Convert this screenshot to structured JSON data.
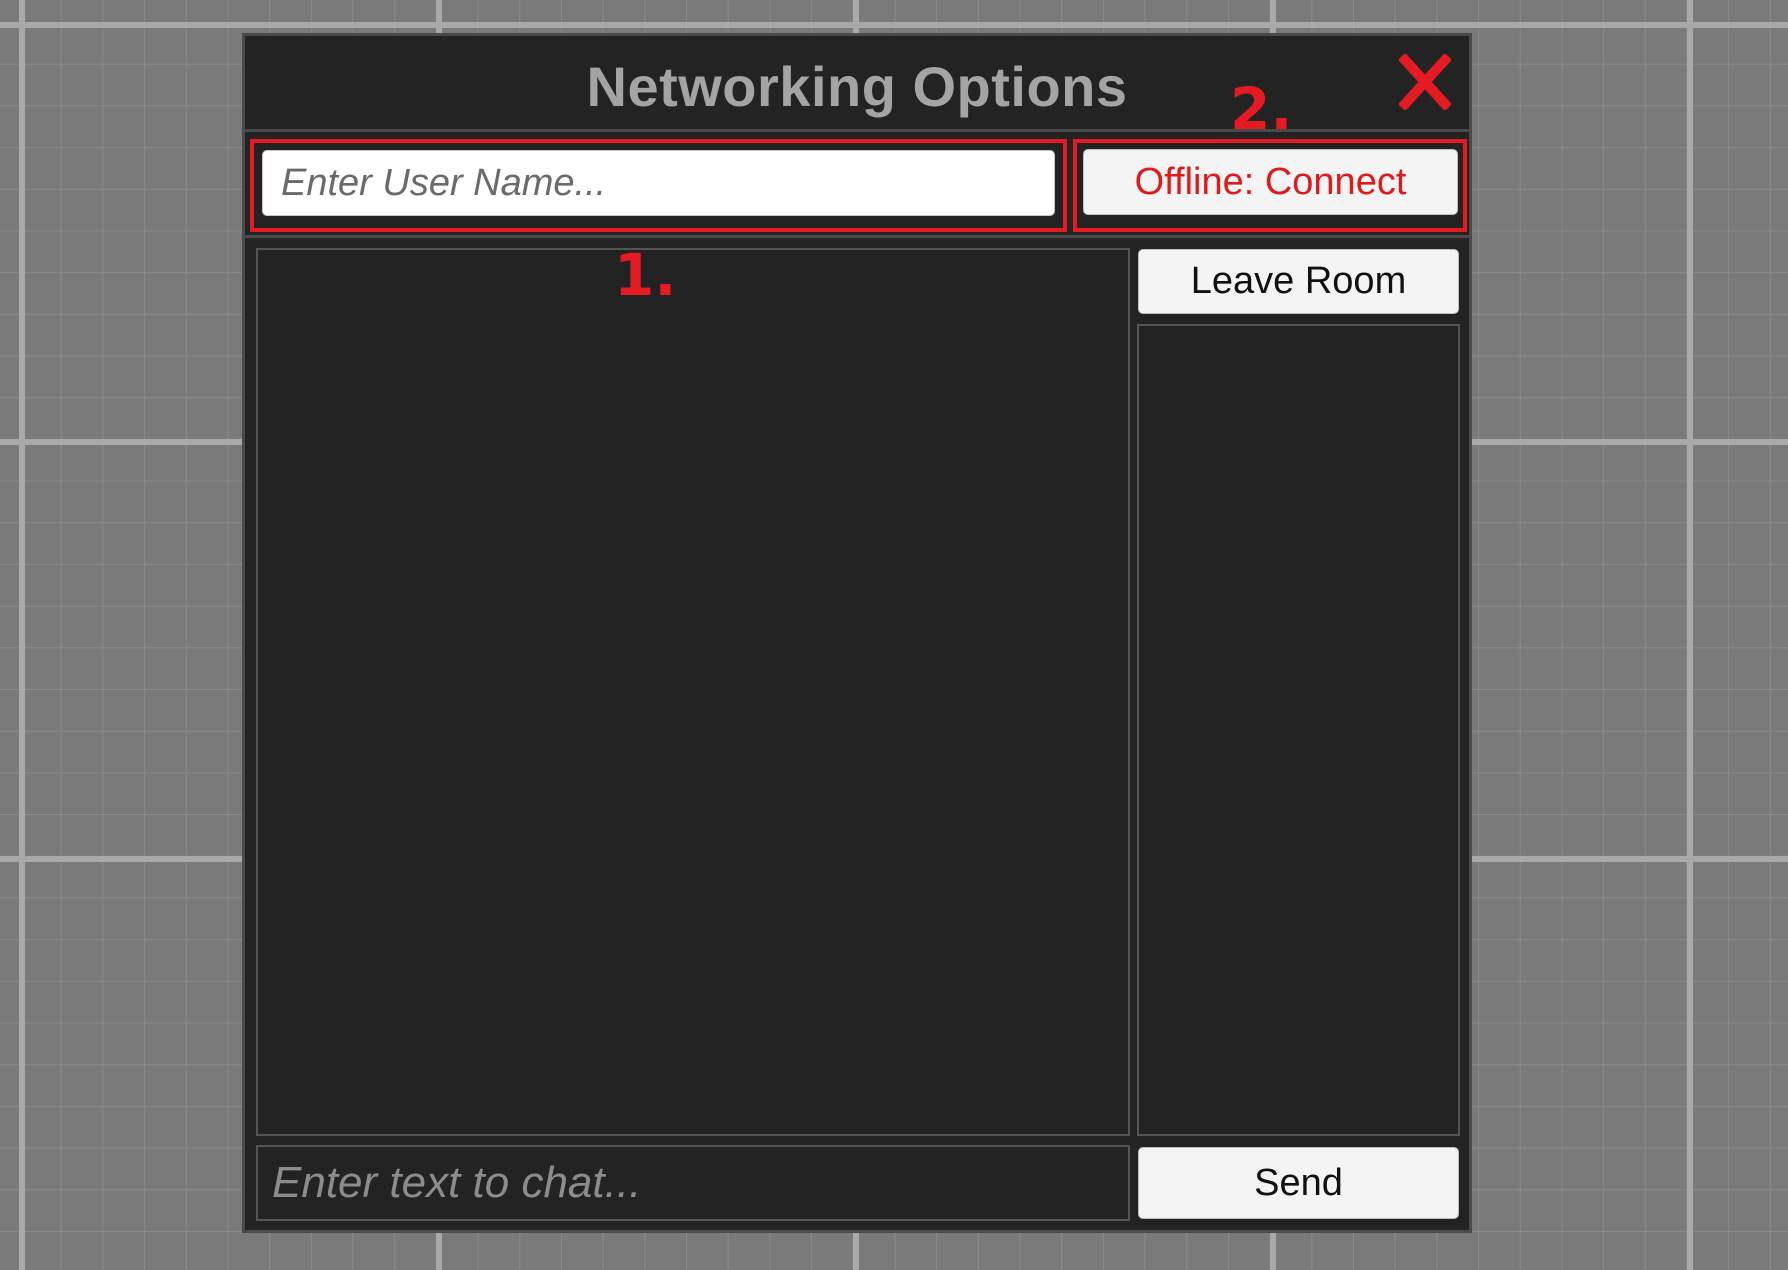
{
  "window": {
    "title": "Networking Options",
    "close_icon": "close-icon",
    "close_icon_color": "#e41b23"
  },
  "top_row": {
    "username_placeholder": "Enter User Name...",
    "username_value": "",
    "connect_label": "Offline: Connect",
    "connect_label_color": "#e01a1a"
  },
  "annotations": {
    "highlight_color": "#e41b23",
    "marker_1": "1.",
    "marker_2": "2."
  },
  "room": {
    "leave_label": "Leave Room",
    "chat_messages": [],
    "players": []
  },
  "chat": {
    "input_placeholder": "Enter text to chat...",
    "input_value": "",
    "send_label": "Send"
  }
}
